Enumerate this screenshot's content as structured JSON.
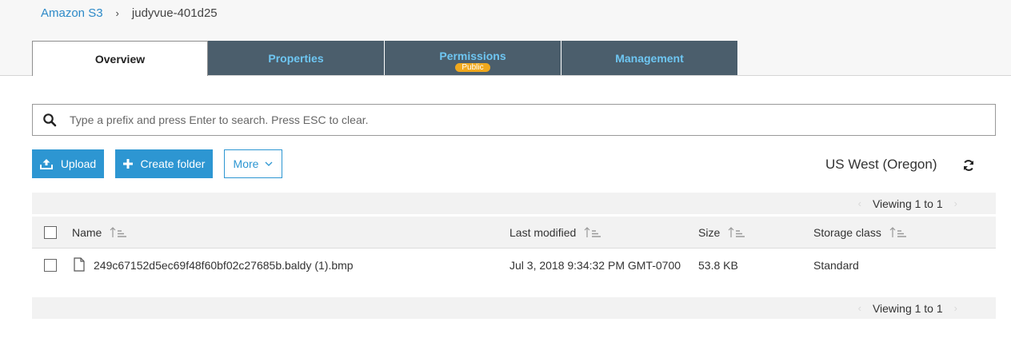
{
  "breadcrumb": {
    "root": "Amazon S3",
    "separator": "›",
    "current": "judyvue-401d25"
  },
  "tabs": [
    {
      "label": "Overview",
      "active": true
    },
    {
      "label": "Properties",
      "active": false
    },
    {
      "label": "Permissions",
      "active": false,
      "badge": "Public"
    },
    {
      "label": "Management",
      "active": false
    }
  ],
  "search": {
    "placeholder": "Type a prefix and press Enter to search. Press ESC to clear.",
    "value": ""
  },
  "actions": {
    "upload": "Upload",
    "create_folder": "Create folder",
    "more": "More"
  },
  "region": "US West (Oregon)",
  "pager": {
    "text": "Viewing 1 to 1",
    "prev": "‹",
    "next": "›"
  },
  "table": {
    "columns": [
      "Name",
      "Last modified",
      "Size",
      "Storage class"
    ],
    "rows": [
      {
        "name": "249c67152d5ec69f48f60bf02c27685b.baldy (1).bmp",
        "last_modified": "Jul 3, 2018 9:34:32 PM GMT-0700",
        "size": "53.8 KB",
        "storage_class": "Standard"
      }
    ]
  },
  "colors": {
    "tab_bg": "#4b5e6c",
    "tab_text": "#6ec6f2",
    "primary": "#2d96d2",
    "badge": "#f0a81d",
    "link": "#2d8ac8"
  },
  "icons": [
    "search-icon",
    "upload-icon",
    "plus-icon",
    "chevron-down-icon",
    "refresh-icon",
    "sort-icon",
    "file-icon"
  ]
}
